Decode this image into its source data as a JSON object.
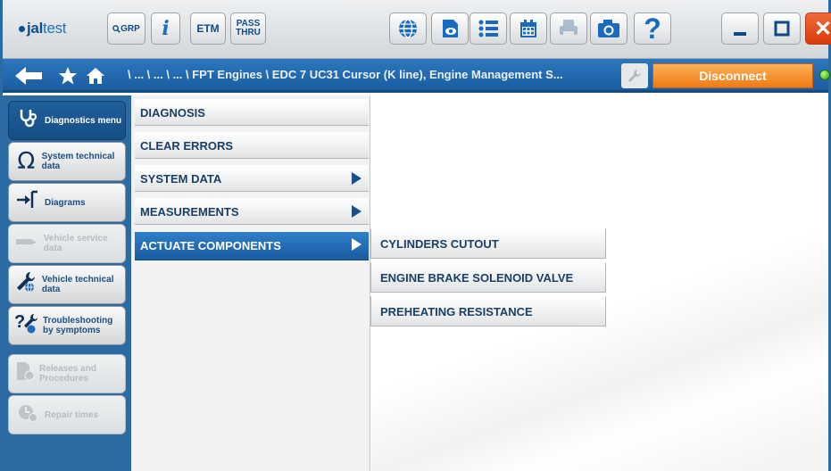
{
  "toolbar": {
    "logo_prefix": "jal",
    "logo_suffix": "test",
    "grp_label": "GRP",
    "info_label": "i",
    "etm_label": "ETM",
    "pass_line1": "PASS",
    "pass_line2": "THRU",
    "help_label": "?",
    "close_label": "✕"
  },
  "nav": {
    "breadcrumb": "\\ ... \\ ... \\ ... \\ FPT Engines \\ EDC 7 UC31 Cursor (K line), Engine Management S...",
    "disconnect_label": "Disconnect"
  },
  "sidebar": {
    "items": [
      {
        "label": "Diagnostics menu",
        "icon": "stethoscope-icon",
        "state": "active"
      },
      {
        "label": "System technical data",
        "icon": "omega-icon",
        "state": "normal"
      },
      {
        "label": "Diagrams",
        "icon": "diagram-icon",
        "state": "normal"
      },
      {
        "label": "Vehicle service data",
        "icon": "service-icon",
        "state": "disabled"
      },
      {
        "label": "Vehicle technical data",
        "icon": "wrench-globe-icon",
        "state": "normal"
      },
      {
        "label": "Troubleshooting by symptoms",
        "icon": "question-wrench-icon",
        "state": "normal"
      },
      {
        "label": "Releases and Procedures",
        "icon": "procedures-icon",
        "state": "disabled"
      },
      {
        "label": "Repair times",
        "icon": "repair-times-icon",
        "state": "disabled"
      }
    ]
  },
  "menu": {
    "items": [
      {
        "label": "DIAGNOSIS",
        "submenu": false
      },
      {
        "label": "CLEAR ERRORS",
        "submenu": false
      },
      {
        "label": "SYSTEM DATA",
        "submenu": true
      },
      {
        "label": "MEASUREMENTS",
        "submenu": true
      },
      {
        "label": "ACTUATE COMPONENTS",
        "submenu": true,
        "selected": true
      }
    ]
  },
  "submenu": {
    "items": [
      {
        "label": "CYLINDERS CUTOUT"
      },
      {
        "label": "ENGINE BRAKE SOLENOID VALVE"
      },
      {
        "label": "PREHEATING RESISTANCE"
      }
    ]
  },
  "colors": {
    "nav_blue": "#2b6aa3",
    "accent_orange": "#ef7a12",
    "close_red": "#d63b0d",
    "selected_blue": "#1a5b9e"
  }
}
